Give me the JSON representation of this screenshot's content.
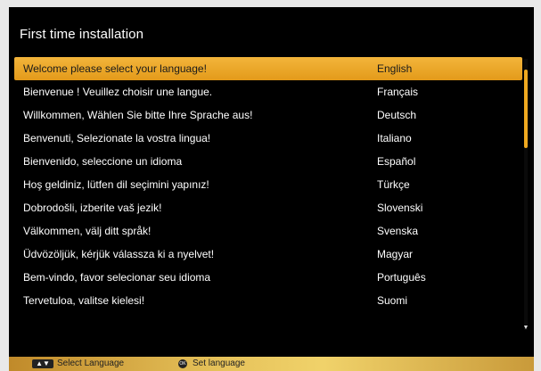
{
  "header": {
    "title": "First time installation"
  },
  "languages": [
    {
      "message": "Welcome please select your language!",
      "name": "English"
    },
    {
      "message": "Bienvenue ! Veuillez choisir une langue.",
      "name": "Français"
    },
    {
      "message": "Willkommen, Wählen Sie bitte Ihre Sprache aus!",
      "name": "Deutsch"
    },
    {
      "message": "Benvenuti, Selezionate la vostra lingua!",
      "name": "Italiano"
    },
    {
      "message": "Bienvenido, seleccione un idioma",
      "name": "Español"
    },
    {
      "message": "Hoş geldiniz, lütfen dil seçimini yapınız!",
      "name": "Türkçe"
    },
    {
      "message": "Dobrodošli, izberite vaš jezik!",
      "name": "Slovenski"
    },
    {
      "message": "Välkommen, välj ditt språk!",
      "name": "Svenska"
    },
    {
      "message": "Üdvözöljük, kérjük válassza ki a nyelvet!",
      "name": "Magyar"
    },
    {
      "message": "Bem-vindo, favor selecionar seu idioma",
      "name": "Português"
    },
    {
      "message": "Tervetuloa, valitse kielesi!",
      "name": "Suomi"
    }
  ],
  "selected_index": 0,
  "footer": {
    "select_label": "Select Language",
    "set_label": "Set language",
    "ok_key": "OK"
  },
  "colors": {
    "highlight": "#f0a920",
    "background": "#000000"
  },
  "icons": {
    "updown": "updown-arrow-icon",
    "ok": "ok-button-icon"
  }
}
